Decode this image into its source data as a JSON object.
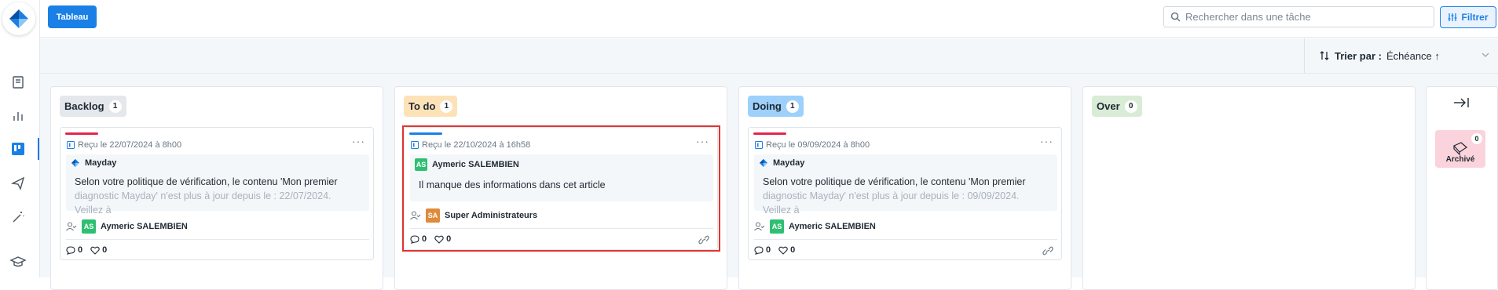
{
  "toolbar": {
    "view_button": "Tableau",
    "search_placeholder": "Rechercher dans une tâche",
    "filter_label": "Filtrer"
  },
  "sort": {
    "label": "Trier par :",
    "value": "Échéance ↑"
  },
  "columns": [
    {
      "title": "Backlog",
      "count": "1",
      "color": "#e4e7eb",
      "card": {
        "accent": "#e3264f",
        "received": "Reçu le 22/07/2024 à 8h00",
        "source": "Mayday",
        "message_line1": "Selon votre politique de vérification, le contenu 'Mon premier",
        "message_line2": "diagnostic Mayday' n'est plus à jour depuis le : 22/07/2024. Veillez à",
        "assignee_initials": "AS",
        "assignee": "Aymeric SALEMBIEN",
        "comments": "0",
        "likes": "0"
      }
    },
    {
      "title": "To do",
      "count": "1",
      "color": "#fde2b8",
      "card": {
        "accent": "#1a80e6",
        "received": "Reçu le 22/10/2024 à 16h58",
        "author_initials": "AS",
        "author": "Aymeric SALEMBIEN",
        "message": "Il manque des informations dans cet article",
        "assignee_initials": "SA",
        "assignee": "Super Administrateurs",
        "comments": "0",
        "likes": "0"
      }
    },
    {
      "title": "Doing",
      "count": "1",
      "color": "#9dd0fb",
      "card": {
        "accent": "#e3264f",
        "received": "Reçu le 09/09/2024 à 8h00",
        "source": "Mayday",
        "message_line1": "Selon votre politique de vérification, le contenu 'Mon premier",
        "message_line2": "diagnostic Mayday' n'est plus à jour depuis le : 09/09/2024. Veillez à",
        "assignee_initials": "AS",
        "assignee": "Aymeric SALEMBIEN",
        "comments": "0",
        "likes": "0"
      }
    },
    {
      "title": "Over",
      "count": "0",
      "color": "#d8ecd6"
    }
  ],
  "archive": {
    "label": "Archivé",
    "count": "0"
  },
  "icons": {
    "logo": "mayday-logo",
    "sidebar": [
      "book-icon",
      "chart-icon",
      "kanban-icon",
      "send-icon",
      "magic-wand-icon",
      "graduation-cap-icon"
    ]
  },
  "colors": {
    "accent": "#1a80e6",
    "highlight": "#e3342f"
  }
}
